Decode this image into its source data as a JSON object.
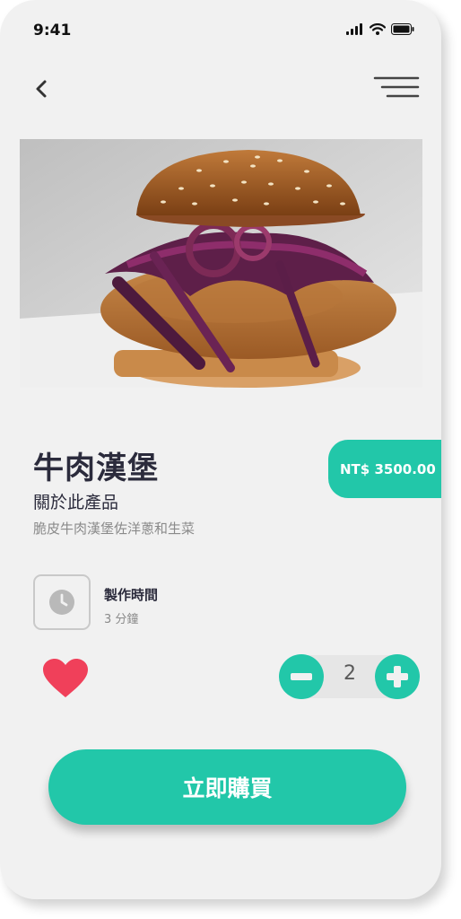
{
  "status_bar": {
    "time": "9:41",
    "icons": [
      "signal-icon",
      "wifi-icon",
      "battery-icon"
    ]
  },
  "nav": {
    "back_icon": "chevron-left-icon",
    "menu_icon": "hamburger-menu-icon"
  },
  "product": {
    "name": "牛肉漢堡",
    "section_title": "關於此產品",
    "description": "脆皮牛肉漢堡佐洋蔥和生菜",
    "price": "NT$ 3500.00"
  },
  "prep_time": {
    "label": "製作時間",
    "value": "3 分鐘",
    "icon": "clock-icon"
  },
  "actions": {
    "favorite_icon": "heart-icon",
    "quantity": "2",
    "decrement_icon": "minus-icon",
    "increment_icon": "plus-icon",
    "buy_label": "立即購買"
  },
  "colors": {
    "accent": "#22c7a9",
    "heart": "#f0405a",
    "text_dark": "#2b2b3c",
    "text_muted": "#8a8a8a",
    "background": "#f1f1f1"
  }
}
